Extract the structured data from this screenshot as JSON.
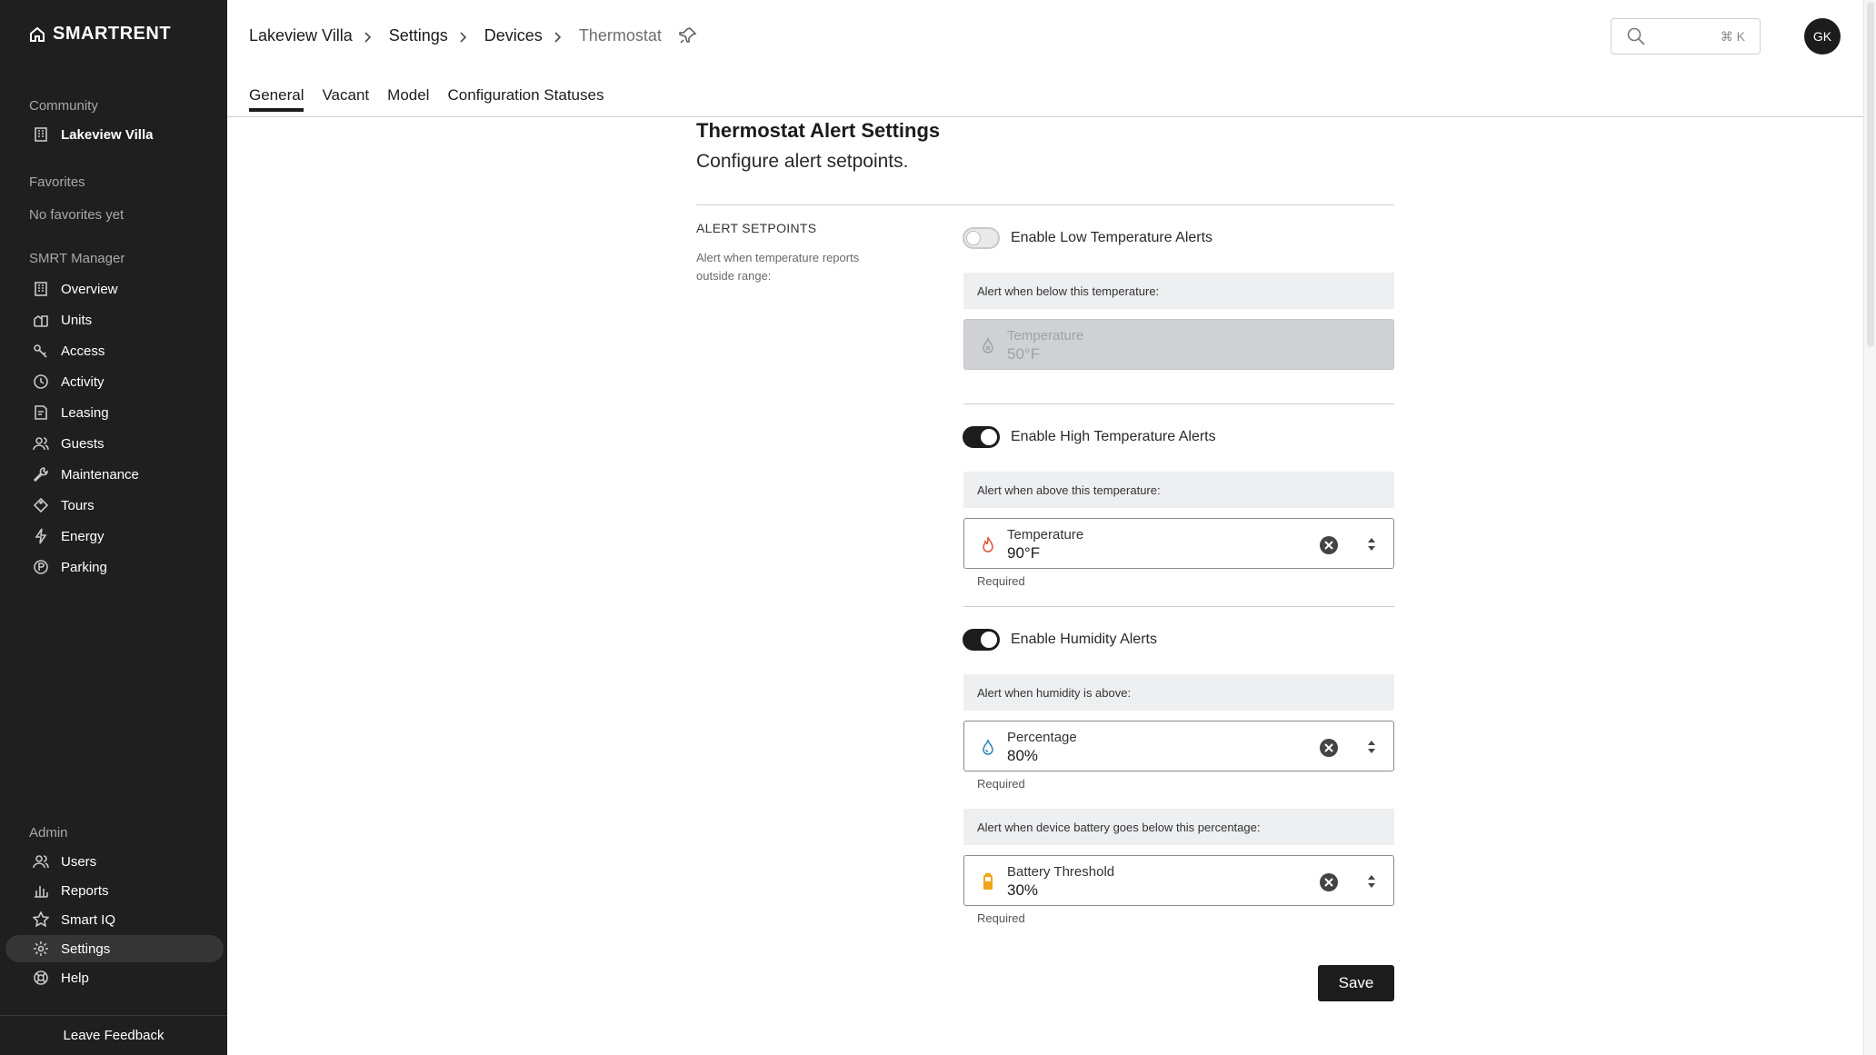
{
  "sidebar": {
    "brand": "SmartRent",
    "community_label": "Community",
    "community_name": "Lakeview Villa",
    "favorites_label": "Favorites",
    "favorites_empty": "No favorites yet",
    "manager_label": "SMRT Manager",
    "manager_items": [
      {
        "label": "Overview",
        "icon": "building-icon"
      },
      {
        "label": "Units",
        "icon": "units-icon"
      },
      {
        "label": "Access",
        "icon": "key-icon"
      },
      {
        "label": "Activity",
        "icon": "clock-icon"
      },
      {
        "label": "Leasing",
        "icon": "leasing-icon"
      },
      {
        "label": "Guests",
        "icon": "guests-icon"
      },
      {
        "label": "Maintenance",
        "icon": "wrench-icon"
      },
      {
        "label": "Tours",
        "icon": "tag-icon"
      },
      {
        "label": "Energy",
        "icon": "bolt-icon"
      },
      {
        "label": "Parking",
        "icon": "parking-icon"
      }
    ],
    "admin_label": "Admin",
    "admin_items": [
      {
        "label": "Users",
        "icon": "users-icon"
      },
      {
        "label": "Reports",
        "icon": "bar-chart-icon"
      },
      {
        "label": "Smart IQ",
        "icon": "star-icon"
      },
      {
        "label": "Settings",
        "icon": "gear-icon"
      },
      {
        "label": "Help",
        "icon": "lifebuoy-icon"
      }
    ],
    "feedback": "Leave Feedback"
  },
  "header": {
    "breadcrumbs": [
      "Lakeview Villa",
      "Settings",
      "Devices",
      "Thermostat"
    ],
    "search_shortcut": "⌘ K",
    "avatar_initials": "GK",
    "tabs": [
      "General",
      "Vacant",
      "Model",
      "Configuration Statuses"
    ],
    "active_tab": "General"
  },
  "content": {
    "title": "Thermostat Alert Settings",
    "subtitle": "Configure alert setpoints.",
    "section_label": "ALERT SETPOINTS",
    "section_desc": "Alert when temperature reports outside range:",
    "low": {
      "toggle_label": "Enable Low Temperature Alerts",
      "enabled": false,
      "hint": "Alert when below this temperature:",
      "field_label": "Temperature",
      "field_value": "50°F"
    },
    "high": {
      "toggle_label": "Enable High Temperature Alerts",
      "enabled": true,
      "hint": "Alert when above this temperature:",
      "field_label": "Temperature",
      "field_value": "90°F",
      "required": "Required"
    },
    "humidity": {
      "toggle_label": "Enable Humidity Alerts",
      "enabled": true,
      "hint": "Alert when humidity is above:",
      "field_label": "Percentage",
      "field_value": "80%",
      "required": "Required"
    },
    "battery": {
      "hint": "Alert when device battery goes below this percentage:",
      "field_label": "Battery Threshold",
      "field_value": "30%",
      "required": "Required"
    },
    "save_label": "Save"
  },
  "colors": {
    "sidebar_bg": "#1f1f1f",
    "accent": "#1c1c1c",
    "flame": "#e0533a",
    "water": "#2d86b8",
    "battery": "#f2a516"
  }
}
